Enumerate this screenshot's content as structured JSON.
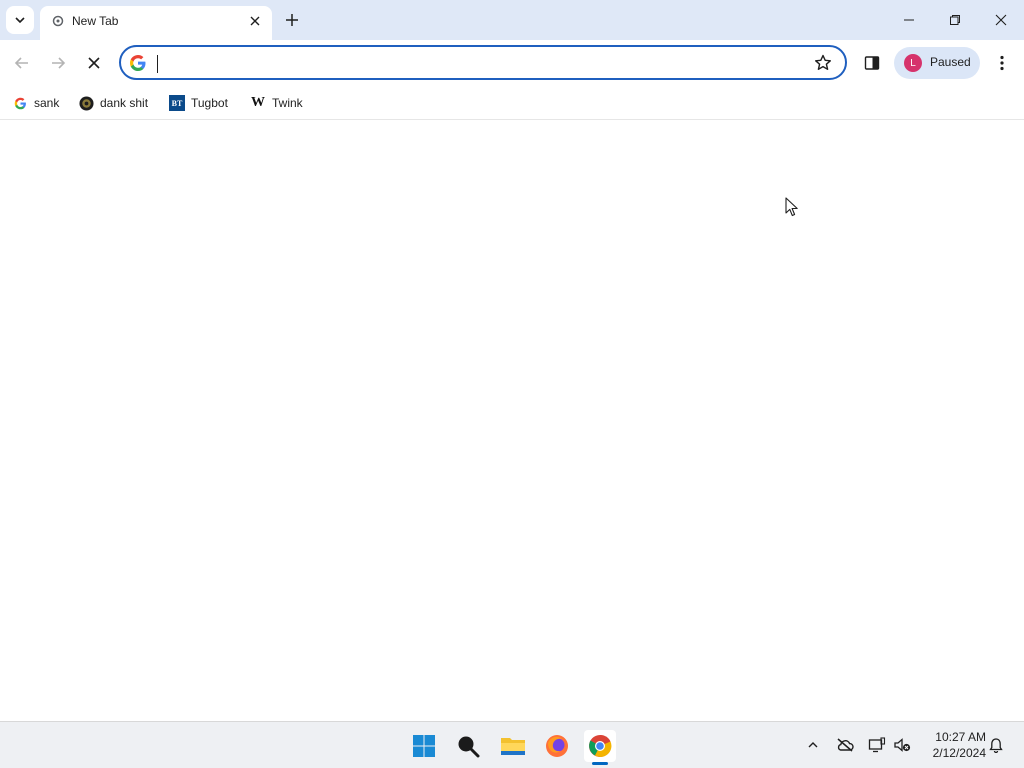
{
  "tab": {
    "title": "New Tab"
  },
  "omnibox": {
    "value": "",
    "placeholder": ""
  },
  "profile": {
    "initial": "L",
    "label": "Paused",
    "color": "#d6336c"
  },
  "bookmarks": [
    {
      "label": "sank",
      "icon": "google-icon"
    },
    {
      "label": "dank shit",
      "icon": "site-icon"
    },
    {
      "label": "Tugbot",
      "icon": "bt-icon",
      "icon_text": "BT"
    },
    {
      "label": "Twink",
      "icon": "w-icon",
      "icon_text": "W"
    }
  ],
  "taskbar": {
    "apps": [
      "windows-start-icon",
      "search-icon",
      "file-explorer-icon",
      "firefox-icon",
      "chrome-icon"
    ],
    "clock": {
      "time": "10:27 AM",
      "date": "2/12/2024"
    }
  },
  "colors": {
    "accent": "#1f5fbf",
    "tabstrip": "#dfe8f7",
    "taskbar": "#eef0f3"
  }
}
